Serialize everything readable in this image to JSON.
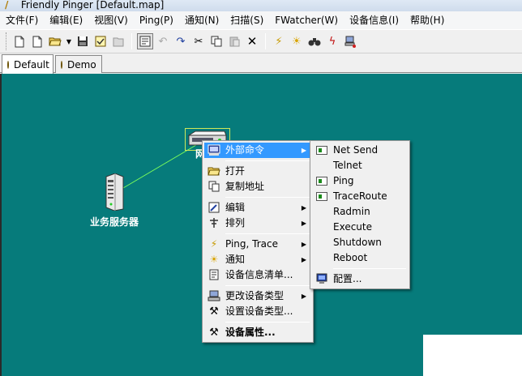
{
  "window": {
    "title": "Friendly Pinger [Default.map]"
  },
  "menubar": [
    "文件(F)",
    "编辑(E)",
    "视图(V)",
    "Ping(P)",
    "通知(N)",
    "扫描(S)",
    "FWatcher(W)",
    "设备信息(I)",
    "帮助(H)"
  ],
  "toolbar": {
    "icons": [
      "new-map-icon",
      "new-document-icon",
      "open-folder-icon",
      "dropdown-icon",
      "save-icon",
      "checklist-icon",
      "folder-icon",
      "edit-mode-icon",
      "undo-icon",
      "redo-icon",
      "cut-icon",
      "copy-icon",
      "paste-icon",
      "delete-icon",
      "ping-icon",
      "alarm-icon",
      "find-icon",
      "scan-icon",
      "network-icon"
    ]
  },
  "tabs": [
    {
      "label": "Default",
      "selected": true
    },
    {
      "label": "Demo",
      "selected": false
    }
  ],
  "canvas": {
    "background": "#067b7b",
    "nodes": [
      {
        "label": "业务服务器",
        "icon": "server-icon"
      },
      {
        "label": "网",
        "icon": "switch-icon"
      }
    ],
    "link_color": "#7cff5a"
  },
  "context_menu": {
    "items": [
      {
        "label": "外部命令",
        "icon": "terminal-icon",
        "submenu": true,
        "highlighted": true
      },
      {
        "separator": true
      },
      {
        "label": "打开",
        "icon": "open-folder-icon"
      },
      {
        "label": "复制地址",
        "icon": "copy-icon"
      },
      {
        "separator": true
      },
      {
        "label": "编辑",
        "icon": "edit-icon",
        "submenu": true
      },
      {
        "label": "排列",
        "icon": "arrange-icon",
        "submenu": true
      },
      {
        "separator": true
      },
      {
        "label": "Ping, Trace",
        "icon": "ping-icon",
        "submenu": true
      },
      {
        "label": "通知",
        "icon": "alarm-icon",
        "submenu": true
      },
      {
        "label": "设备信息清单...",
        "icon": "info-list-icon"
      },
      {
        "separator": true
      },
      {
        "label": "更改设备类型",
        "icon": "computer-icon",
        "submenu": true
      },
      {
        "label": "设置设备类型...",
        "icon": "tools-icon"
      },
      {
        "separator": true
      },
      {
        "label": "设备属性...",
        "icon": "tools-icon",
        "bold": true
      }
    ]
  },
  "submenu": {
    "items": [
      {
        "label": "Net Send",
        "icon": "window-icon"
      },
      {
        "label": "Telnet",
        "icon": ""
      },
      {
        "label": "Ping",
        "icon": "window-icon"
      },
      {
        "label": "TraceRoute",
        "icon": "window-icon"
      },
      {
        "label": "Radmin",
        "icon": ""
      },
      {
        "label": "Execute",
        "icon": ""
      },
      {
        "label": "Shutdown",
        "icon": ""
      },
      {
        "label": "Reboot",
        "icon": ""
      },
      {
        "separator": true
      },
      {
        "label": "配置...",
        "icon": "monitor-icon"
      }
    ]
  }
}
